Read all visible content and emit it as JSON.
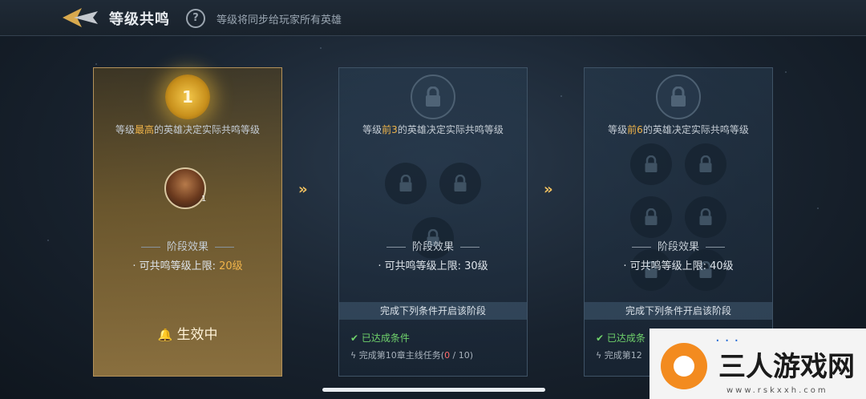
{
  "header": {
    "title": "等级共鸣",
    "help_label": "?",
    "subtitle": "等级将同步给玩家所有英雄"
  },
  "stages": [
    {
      "badge": "1",
      "desc_pre": "等级",
      "desc_hl": "最高",
      "desc_post": "的英雄决定实际共鸣等级",
      "hero_level": "1",
      "effect_title": "阶段效果",
      "effect_label": "· 可共鸣等级上限:",
      "effect_value": "20级",
      "status": "生效中"
    },
    {
      "desc_pre": "等级",
      "desc_hl": "前3",
      "desc_post": "的英雄决定实际共鸣等级",
      "effect_title": "阶段效果",
      "effect_label": "· 可共鸣等级上限:",
      "effect_value": "30级",
      "condition_title": "完成下列条件开启该阶段",
      "condition_ok": "✔ 已达成条件",
      "task_label": "完成第10章主线任务(",
      "task_current": "0",
      "task_total": " / 10)"
    },
    {
      "desc_pre": "等级",
      "desc_hl": "前6",
      "desc_post": "的英雄决定实际共鸣等级",
      "effect_title": "阶段效果",
      "effect_label": "· 可共鸣等级上限:",
      "effect_value": "40级",
      "condition_title": "完成下列条件开启该阶段",
      "condition_ok": "✔ 已达成条",
      "task_label": "完成第12"
    }
  ],
  "arrows": [
    "»",
    "»"
  ],
  "watermark": {
    "text": "三人游戏网",
    "url": "www.rskxxh.com",
    "top": "..."
  },
  "colors": {
    "highlight": "#f0b44a",
    "ok": "#6fd26b",
    "progress_current": "#ff6b6b",
    "active_border": "#b4925a"
  }
}
